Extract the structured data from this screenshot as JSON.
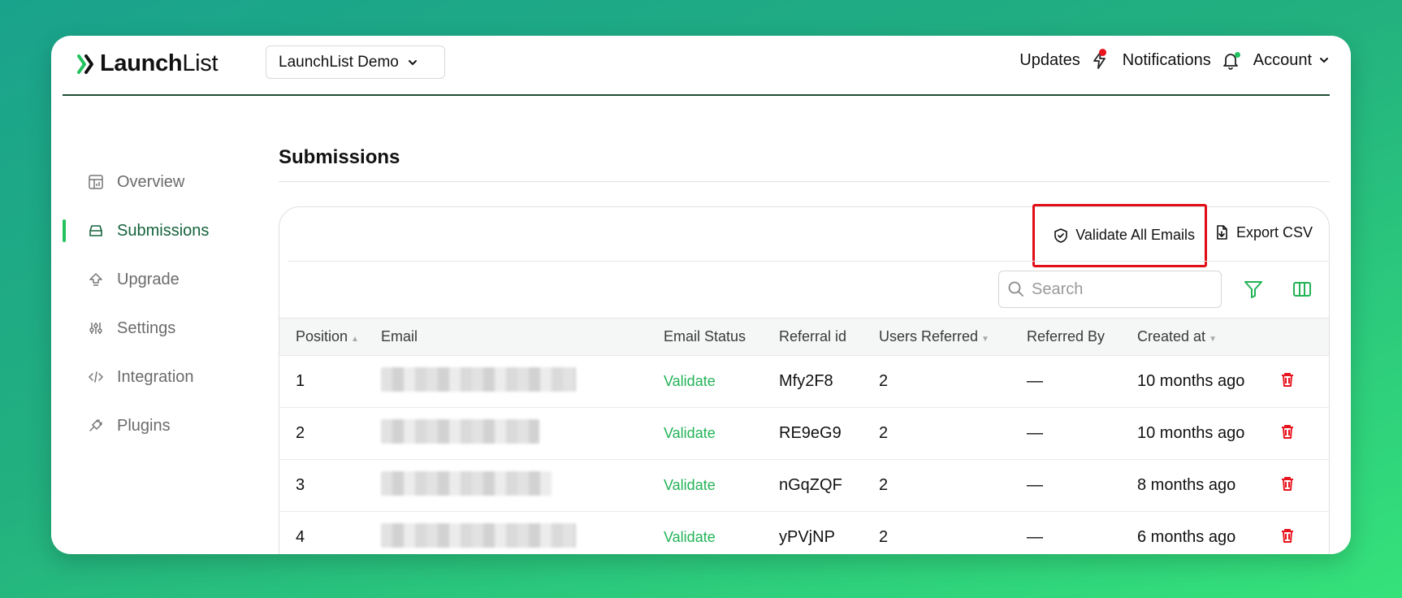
{
  "app": {
    "logo_bold": "Launch",
    "logo_light": "List",
    "workspace": "LaunchList Demo"
  },
  "nav": {
    "updates": "Updates",
    "notifications": "Notifications",
    "account": "Account"
  },
  "sidebar": {
    "items": [
      {
        "label": "Overview",
        "icon": "chart-grid-icon",
        "active": false
      },
      {
        "label": "Submissions",
        "icon": "inbox-icon",
        "active": true
      },
      {
        "label": "Upgrade",
        "icon": "upgrade-arrow-icon",
        "active": false
      },
      {
        "label": "Settings",
        "icon": "sliders-icon",
        "active": false
      },
      {
        "label": "Integration",
        "icon": "code-icon",
        "active": false
      },
      {
        "label": "Plugins",
        "icon": "plug-icon",
        "active": false
      }
    ]
  },
  "main": {
    "title": "Submissions",
    "validate_all": "Validate All Emails",
    "export_csv": "Export CSV",
    "search_placeholder": "Search"
  },
  "table": {
    "columns": [
      "Position",
      "Email",
      "Email Status",
      "Referral id",
      "Users Referred",
      "Referred By",
      "Created at"
    ],
    "rows": [
      {
        "position": "1",
        "email_status": "Validate",
        "referral_id": "Mfy2F8",
        "users_referred": "2",
        "referred_by": "—",
        "created_at": "10 months ago"
      },
      {
        "position": "2",
        "email_status": "Validate",
        "referral_id": "RE9eG9",
        "users_referred": "2",
        "referred_by": "—",
        "created_at": "10 months ago"
      },
      {
        "position": "3",
        "email_status": "Validate",
        "referral_id": "nGqZQF",
        "users_referred": "2",
        "referred_by": "—",
        "created_at": "8 months ago"
      },
      {
        "position": "4",
        "email_status": "Validate",
        "referral_id": "yPVjNP",
        "users_referred": "2",
        "referred_by": "—",
        "created_at": "6 months ago"
      }
    ]
  },
  "colors": {
    "accent": "#22c35e",
    "active_text": "#15633c",
    "delete": "#e8141e",
    "highlight_box": "#e10d17"
  }
}
